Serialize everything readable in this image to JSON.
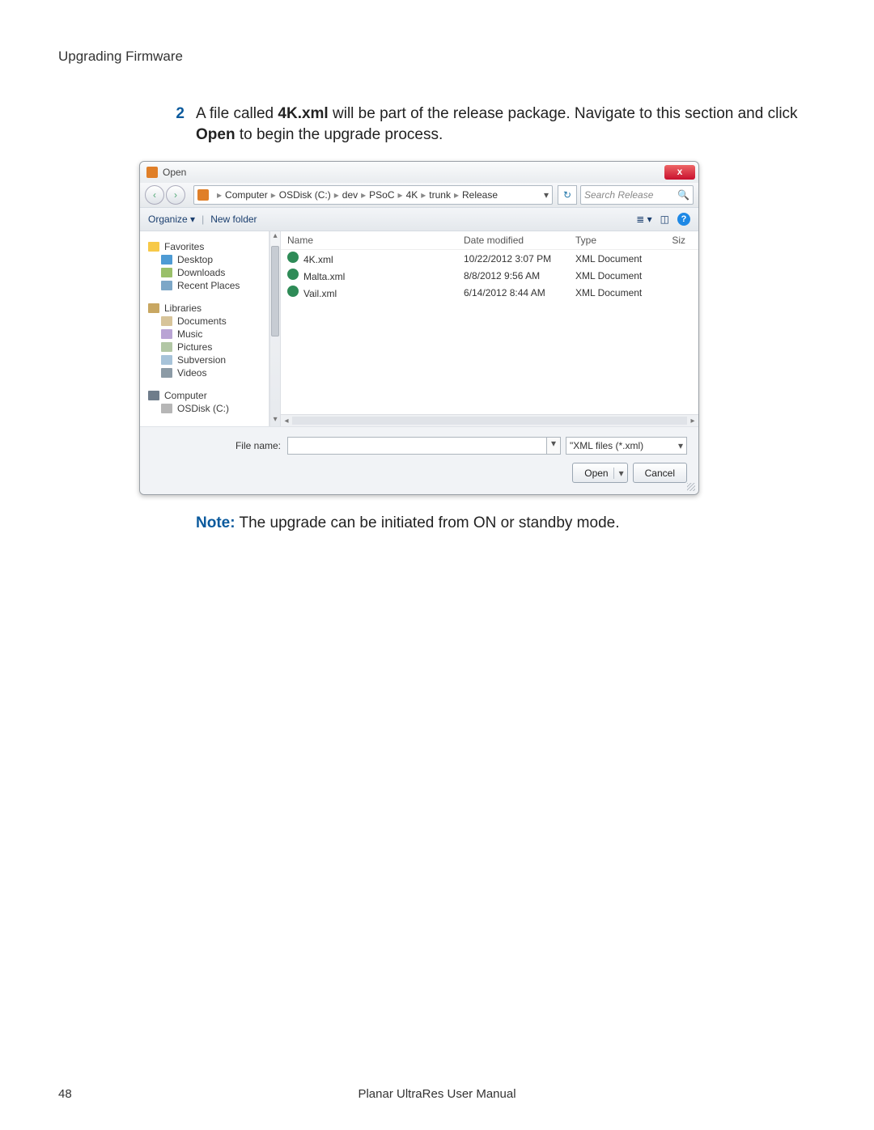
{
  "doc": {
    "running_head": "Upgrading Firmware",
    "step_number": "2",
    "step_text_1": "A file called ",
    "step_bold_1": "4K.xml",
    "step_text_2": " will be part of the release package. Navigate to this section and click ",
    "step_bold_2": "Open",
    "step_text_3": " to begin the upgrade process.",
    "note_label": "Note:",
    "note_text": " The upgrade can be initiated from ON or standby mode.",
    "page_number": "48",
    "footer_title": "Planar UltraRes User Manual"
  },
  "dlg": {
    "title": "Open",
    "close": "x",
    "nav_back": "‹",
    "nav_fwd": "›",
    "refresh": "↻",
    "search_placeholder": "Search Release",
    "search_icon": "🔍",
    "breadcrumb": [
      "Computer",
      "OSDisk (C:)",
      "dev",
      "PSoC",
      "4K",
      "trunk",
      "Release"
    ],
    "toolbar": {
      "organize": "Organize ▾",
      "newfolder": "New folder",
      "view": "≣ ▾",
      "preview": "◫",
      "help": "?"
    },
    "tree": {
      "favorites": "Favorites",
      "favorites_items": [
        "Desktop",
        "Downloads",
        "Recent Places"
      ],
      "libraries": "Libraries",
      "libraries_items": [
        "Documents",
        "Music",
        "Pictures",
        "Subversion",
        "Videos"
      ],
      "computer": "Computer",
      "computer_items": [
        "OSDisk (C:)"
      ]
    },
    "columns": {
      "name": "Name",
      "date": "Date modified",
      "type": "Type",
      "size": "Siz"
    },
    "files": [
      {
        "name": "4K.xml",
        "date": "10/22/2012 3:07 PM",
        "type": "XML Document"
      },
      {
        "name": "Malta.xml",
        "date": "8/8/2012 9:56 AM",
        "type": "XML Document"
      },
      {
        "name": "Vail.xml",
        "date": "6/14/2012 8:44 AM",
        "type": "XML Document"
      }
    ],
    "filename_label": "File name:",
    "filter": "\"XML files (*.xml)",
    "open": "Open",
    "cancel": "Cancel"
  }
}
